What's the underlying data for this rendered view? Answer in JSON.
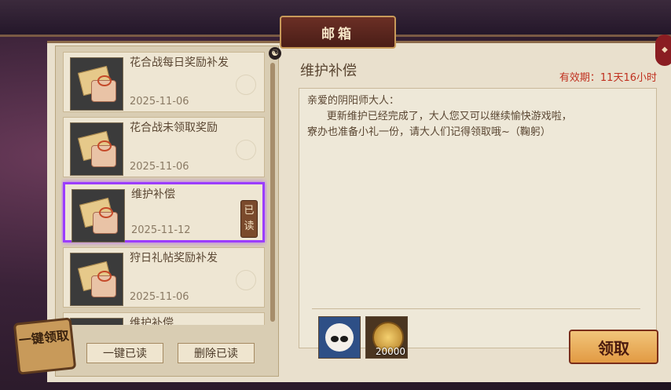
{
  "window": {
    "title": "邮箱"
  },
  "mail_list": [
    {
      "title": "花合战每日奖励补发",
      "date": "2025-11-06",
      "selected": false,
      "read_tag": ""
    },
    {
      "title": "花合战未领取奖励",
      "date": "2025-11-06",
      "selected": false,
      "read_tag": ""
    },
    {
      "title": "维护补偿",
      "date": "2025-11-12",
      "selected": true,
      "read_tag": "已读"
    },
    {
      "title": "狩日礼帖奖励补发",
      "date": "2025-11-06",
      "selected": false,
      "read_tag": ""
    },
    {
      "title": "维护补偿",
      "date": "",
      "selected": false,
      "read_tag": ""
    }
  ],
  "buttons": {
    "read_all": "一键已读",
    "delete_read": "删除已读",
    "claim_all": "一键领取",
    "claim": "领取"
  },
  "detail": {
    "subject": "维护补偿",
    "expiry": "有效期：11天16小时",
    "content": "亲爱的阴阳师大人：\n      更新维护已经完成了，大人您又可以继续愉快游戏啦，\n寮办也准备小礼一份，请大人们记得领取哦~（鞠躬）",
    "rewards": [
      {
        "icon": "shikigami-face-icon",
        "quantity": ""
      },
      {
        "icon": "gold-coin-icon",
        "quantity": "20000"
      }
    ]
  },
  "colors": {
    "accent": "#9b3dff",
    "expiry": "#c0301f",
    "claim": "#e29a43"
  }
}
